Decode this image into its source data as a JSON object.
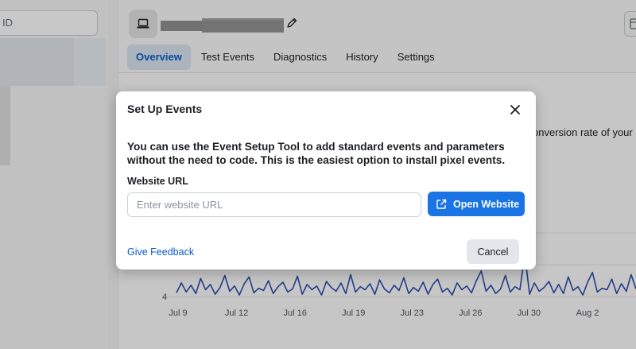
{
  "sidebar": {
    "search": {
      "value": "ID"
    }
  },
  "header": {
    "tabs": [
      {
        "label": "Overview",
        "active": true
      },
      {
        "label": "Test Events",
        "active": false
      },
      {
        "label": "Diagnostics",
        "active": false
      },
      {
        "label": "History",
        "active": false
      },
      {
        "label": "Settings",
        "active": false
      }
    ]
  },
  "overview": {
    "description_fragment": "onversion rate of your L"
  },
  "chart_data": {
    "type": "line",
    "x_tick_labels": [
      "Jul 9",
      "Jul 12",
      "Jul 16",
      "Jul 19",
      "Jul 23",
      "Jul 26",
      "Jul 30",
      "Aug 2"
    ],
    "y_tick_labels": [
      "4"
    ],
    "series": [
      {
        "values": [
          4.5,
          5.8,
          4.6,
          5.5,
          4.4,
          6.4,
          4.9,
          5.6,
          4.3,
          5.2,
          6.8,
          4.7,
          5.4,
          4.2,
          5.7,
          6.6,
          4.5,
          5.1,
          4.8,
          6.1,
          4.4,
          5.3,
          5.9,
          4.6,
          5.0,
          6.7,
          4.3,
          5.6,
          4.9,
          5.4,
          4.2,
          6.0,
          5.2,
          4.7,
          5.8,
          4.4,
          6.9,
          4.6,
          5.3,
          4.9,
          5.7,
          4.3,
          6.2,
          5.0,
          4.5,
          5.5,
          4.8,
          6.5,
          4.4,
          5.2,
          4.7,
          5.9,
          4.3,
          5.6,
          6.3,
          4.6,
          5.1,
          4.2,
          5.8,
          4.9,
          5.4,
          4.5,
          6.1,
          7.4,
          4.7,
          5.5,
          4.4,
          5.0,
          6.8,
          4.6,
          5.3,
          4.9,
          9.6,
          4.3,
          5.8,
          4.7,
          5.2,
          6.0,
          4.5,
          5.6,
          4.4,
          6.6,
          4.8,
          5.3,
          4.2,
          5.9,
          7.2,
          4.6,
          5.1,
          4.9,
          6.3,
          4.4,
          5.7,
          4.7,
          6.9,
          5.0
        ]
      }
    ]
  },
  "modal": {
    "title": "Set Up Events",
    "description": "You can use the Event Setup Tool to add standard events and parameters without the need to code. This is the easiest option to install pixel events.",
    "url_label": "Website URL",
    "url_placeholder": "Enter website URL",
    "url_value": "",
    "open_button": "Open Website",
    "feedback_link": "Give Feedback",
    "cancel_button": "Cancel"
  },
  "colors": {
    "primary": "#1b74e4",
    "link": "#0a5bc4",
    "chart_line": "#2b4aa8"
  }
}
